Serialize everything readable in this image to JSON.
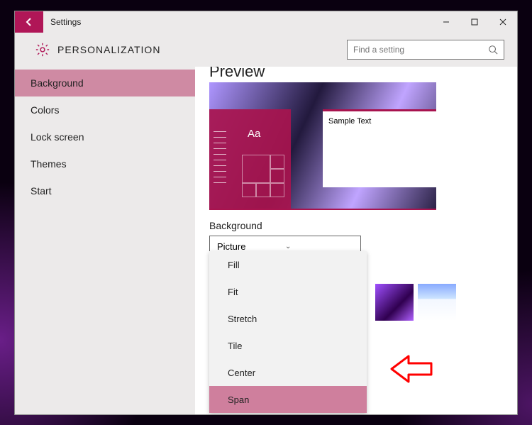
{
  "app": {
    "title": "Settings",
    "section": "PERSONALIZATION"
  },
  "search": {
    "placeholder": "Find a setting"
  },
  "sidebar": {
    "items": [
      {
        "label": "Background",
        "active": true
      },
      {
        "label": "Colors"
      },
      {
        "label": "Lock screen"
      },
      {
        "label": "Themes"
      },
      {
        "label": "Start"
      }
    ]
  },
  "content": {
    "preview_label": "Preview",
    "sample_window_text": "Sample Text",
    "sample_aa": "Aa",
    "background_label": "Background",
    "background_selected": "Picture",
    "fit_options": [
      "Fill",
      "Fit",
      "Stretch",
      "Tile",
      "Center",
      "Span"
    ],
    "fit_hover_index": 5
  },
  "colors": {
    "accent": "#b01657",
    "accent_light": "#cf8aa3"
  }
}
